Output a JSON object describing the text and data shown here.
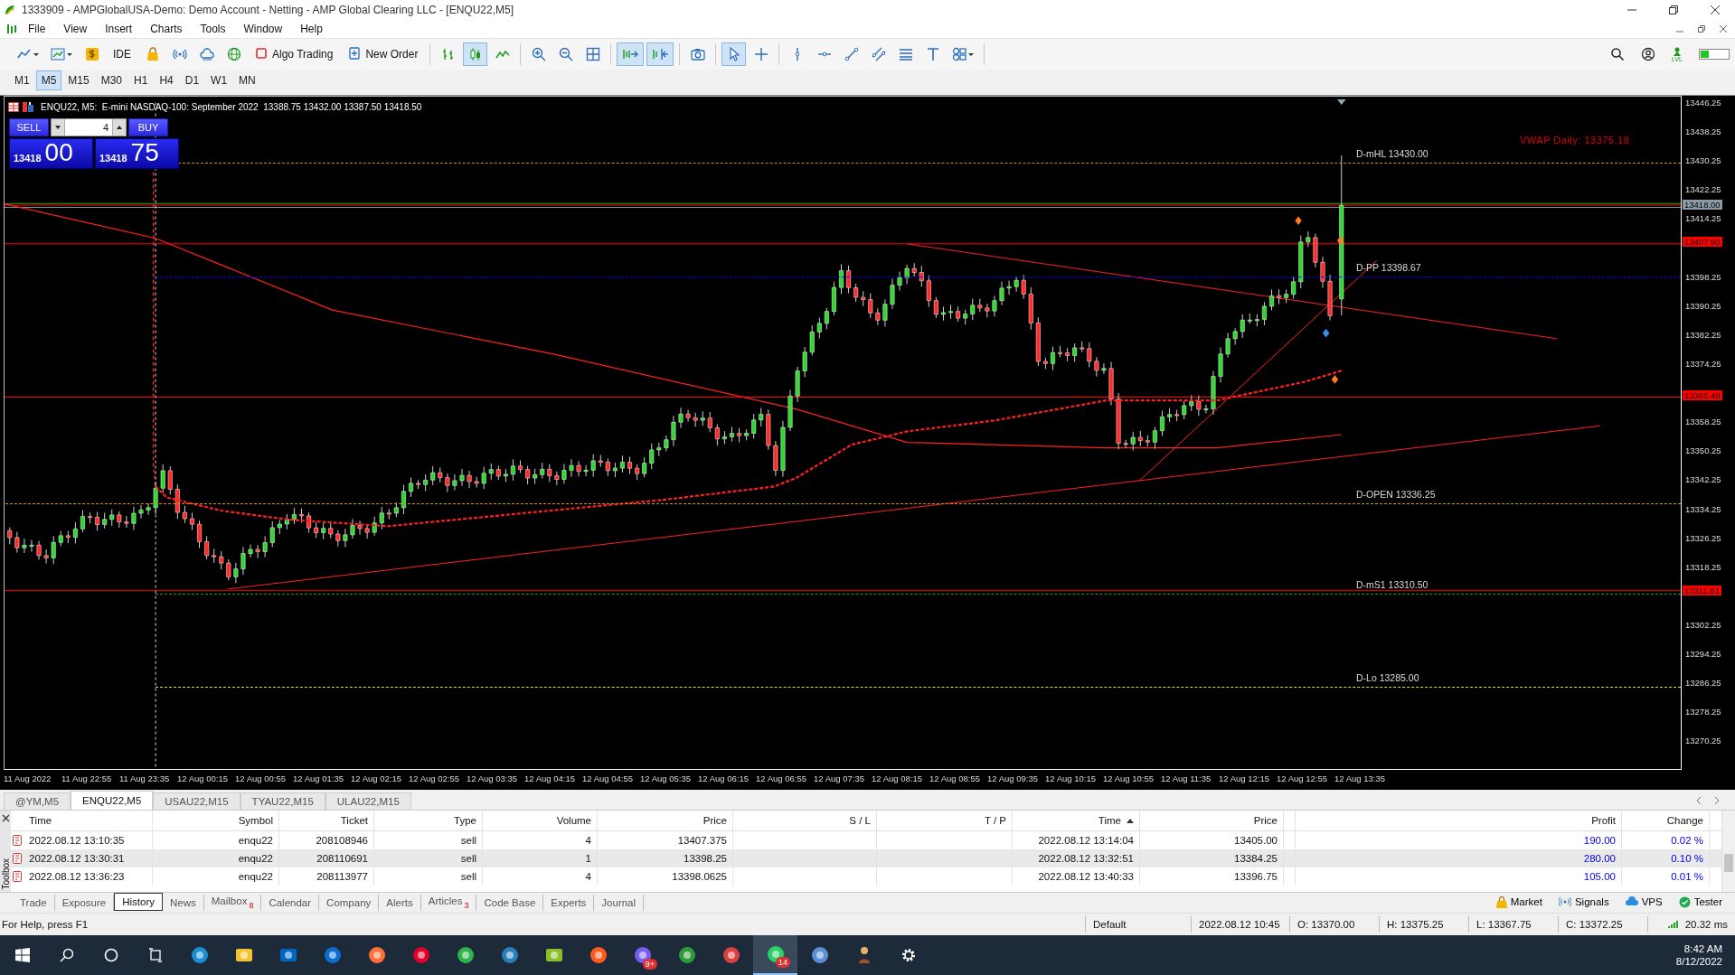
{
  "window": {
    "title": "1333909 - AMPGlobalUSA-Demo: Demo Account - Netting - AMP Global Clearing LLC - [ENQU22,M5]"
  },
  "menu": [
    "File",
    "View",
    "Insert",
    "Charts",
    "Tools",
    "Window",
    "Help"
  ],
  "toolbar": {
    "groups": [
      [
        {
          "kind": "icon",
          "pressed": false
        },
        {
          "kind": "icon",
          "pressed": false
        },
        {
          "kind": "icon",
          "pressed": false
        },
        {
          "kind": "text",
          "label": "IDE",
          "pressed": false
        },
        {
          "kind": "icon",
          "pressed": false
        },
        {
          "kind": "icon",
          "pressed": false
        },
        {
          "kind": "icon",
          "pressed": false
        },
        {
          "kind": "icon",
          "pressed": false
        },
        {
          "kind": "text",
          "label": "Algo Trading",
          "pressed": false
        },
        {
          "kind": "text",
          "label": "New Order",
          "pressed": false
        }
      ],
      [
        {
          "kind": "icon",
          "pressed": false
        },
        {
          "kind": "icon",
          "pressed": true
        },
        {
          "kind": "icon",
          "pressed": false
        }
      ],
      [
        {
          "kind": "icon",
          "pressed": false
        },
        {
          "kind": "icon",
          "pressed": false
        },
        {
          "kind": "icon",
          "pressed": false
        }
      ],
      [
        {
          "kind": "icon",
          "pressed": true
        },
        {
          "kind": "icon",
          "pressed": true
        }
      ],
      [
        {
          "kind": "icon",
          "pressed": false
        }
      ],
      [
        {
          "kind": "icon",
          "pressed": true
        },
        {
          "kind": "icon",
          "pressed": false
        }
      ],
      [
        {
          "kind": "icon",
          "pressed": false
        },
        {
          "kind": "icon",
          "pressed": false
        },
        {
          "kind": "icon",
          "pressed": false
        },
        {
          "kind": "icon",
          "pressed": false
        },
        {
          "kind": "icon",
          "pressed": false
        },
        {
          "kind": "icon",
          "pressed": false
        },
        {
          "kind": "icon",
          "pressed": false
        }
      ]
    ],
    "lvl_label": "LVL"
  },
  "timeframes": [
    {
      "label": "M1",
      "selected": false
    },
    {
      "label": "M5",
      "selected": true
    },
    {
      "label": "M15",
      "selected": false
    },
    {
      "label": "M30",
      "selected": false
    },
    {
      "label": "H1",
      "selected": false
    },
    {
      "label": "H4",
      "selected": false
    },
    {
      "label": "D1",
      "selected": false
    },
    {
      "label": "W1",
      "selected": false
    },
    {
      "label": "MN",
      "selected": false
    }
  ],
  "chart": {
    "header": "ENQU22, M5:  E-mini NASDAQ-100: September 2022  13388.75 13432.00 13387.50 13418.50",
    "trade_panel": {
      "sell": "SELL",
      "buy": "BUY",
      "volume": "4",
      "bid_big": "13418",
      "bid_small": "00",
      "ask_big": "13418",
      "ask_small": "75"
    },
    "vwap_label": "VWAP Daily: 13375.18",
    "levels": [
      {
        "label": "D-mHL 13430.00",
        "color": "#e08a00"
      },
      {
        "label": "D-PP 13398.67",
        "color": "#0000ff"
      },
      {
        "label": "D-OPEN 13336.25",
        "color": "#d69400"
      },
      {
        "label": "D-mS1 13310.50",
        "color": "#1f9e1f"
      },
      {
        "label": "D-Lo 13285.00",
        "color": "#e6e600"
      }
    ],
    "price_ticks": [
      "13446.25",
      "13438.25",
      "13430.25",
      "13422.25",
      "13414.25",
      "13398.25",
      "13390.25",
      "13382.25",
      "13374.25",
      "13358.25",
      "13350.25",
      "13342.25",
      "13334.25",
      "13326.25",
      "13318.25",
      "13302.25",
      "13294.25",
      "13286.25",
      "13278.25",
      "13270.25"
    ],
    "price_markers": [
      {
        "label": "13418.00",
        "color": "#8c9aa8"
      },
      {
        "label": "13407.90",
        "color": "#ff0000"
      },
      {
        "label": "13365.48",
        "color": "#ff0000"
      },
      {
        "label": "13311.61",
        "color": "#ff0000"
      }
    ],
    "time_ticks": [
      "11 Aug 2022",
      "11 Aug 22:55",
      "11 Aug 23:35",
      "12 Aug 00:15",
      "12 Aug 00:55",
      "12 Aug 01:35",
      "12 Aug 02:15",
      "12 Aug 02:55",
      "12 Aug 03:35",
      "12 Aug 04:15",
      "12 Aug 04:55",
      "12 Aug 05:35",
      "12 Aug 06:15",
      "12 Aug 06:55",
      "12 Aug 07:35",
      "12 Aug 08:15",
      "12 Aug 08:55",
      "12 Aug 09:35",
      "12 Aug 10:15",
      "12 Aug 10:55",
      "12 Aug 11:35",
      "12 Aug 12:15",
      "12 Aug 12:55",
      "12 Aug 13:35"
    ]
  },
  "chart_tabs": [
    {
      "label": "@YM,M5",
      "selected": false
    },
    {
      "label": "ENQU22,M5",
      "selected": true
    },
    {
      "label": "USAU22,M15",
      "selected": false
    },
    {
      "label": "TYAU22,M15",
      "selected": false
    },
    {
      "label": "ULAU22,M15",
      "selected": false
    }
  ],
  "table": {
    "columns": [
      "Time",
      "Symbol",
      "Ticket",
      "Type",
      "Volume",
      "Price",
      "S / L",
      "T / P",
      "Time",
      "Price",
      "",
      "Profit",
      "Change"
    ],
    "rows": [
      [
        "2022.08.12 13:10:35",
        "enqu22",
        "208108946",
        "sell",
        "4",
        "13407.375",
        "",
        "",
        "2022.08.12 13:14:04",
        "13405.00",
        "",
        "190.00",
        "0.02 %"
      ],
      [
        "2022.08.12 13:30:31",
        "enqu22",
        "208110691",
        "sell",
        "1",
        "13398.25",
        "",
        "",
        "2022.08.12 13:32:51",
        "13384.25",
        "",
        "280.00",
        "0.10 %"
      ],
      [
        "2022.08.12 13:36:23",
        "enqu22",
        "208113977",
        "sell",
        "4",
        "13398.0625",
        "",
        "",
        "2022.08.12 13:40:33",
        "13396.75",
        "",
        "105.00",
        "0.01 %"
      ]
    ]
  },
  "toolbox": {
    "label": "Toolbox",
    "tabs": [
      {
        "label": "Trade",
        "selected": false
      },
      {
        "label": "Exposure",
        "selected": false
      },
      {
        "label": "History",
        "selected": true
      },
      {
        "label": "News",
        "selected": false
      },
      {
        "label": "Mailbox",
        "badge": "8",
        "selected": false
      },
      {
        "label": "Calendar",
        "selected": false
      },
      {
        "label": "Company",
        "selected": false
      },
      {
        "label": "Alerts",
        "selected": false
      },
      {
        "label": "Articles",
        "badge": "3",
        "selected": false
      },
      {
        "label": "Code Base",
        "selected": false
      },
      {
        "label": "Experts",
        "selected": false
      },
      {
        "label": "Journal",
        "selected": false
      }
    ],
    "services": [
      "Market",
      "Signals",
      "VPS",
      "Tester"
    ]
  },
  "status_bar": {
    "help": "For Help, press F1",
    "profile": "Default",
    "time": "2022.08.12 10:45",
    "open": "O: 13370.00",
    "high": "H: 13375.25",
    "low": "L: 13367.75",
    "close": "C: 13372.25",
    "ping": "20.32 ms"
  },
  "taskbar": {
    "items": [
      {
        "selected": false
      },
      {
        "selected": false
      },
      {
        "selected": false
      },
      {
        "selected": false
      },
      {
        "selected": false
      },
      {
        "selected": false
      },
      {
        "selected": false
      },
      {
        "selected": false
      },
      {
        "selected": false
      },
      {
        "selected": false
      },
      {
        "selected": false
      },
      {
        "selected": false
      },
      {
        "selected": false
      },
      {
        "selected": false
      },
      {
        "selected": false,
        "badge": "9+"
      },
      {
        "selected": false
      },
      {
        "selected": false
      },
      {
        "selected": true,
        "badge": "14"
      },
      {
        "selected": false
      },
      {
        "selected": false
      },
      {
        "selected": false
      }
    ],
    "time": "8:42 AM",
    "date": "8/12/2022"
  }
}
